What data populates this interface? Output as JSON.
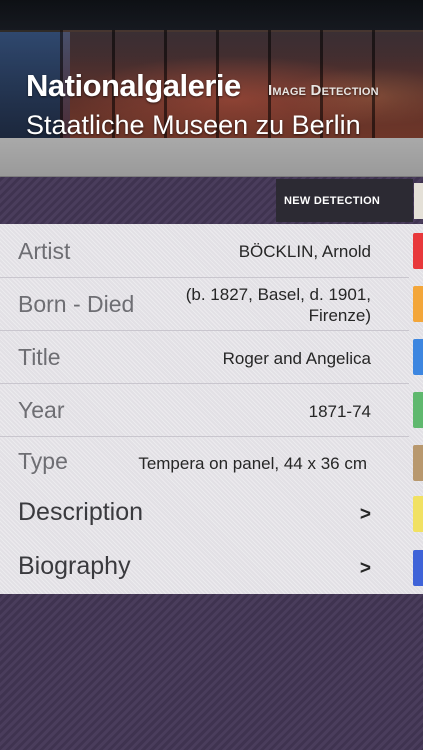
{
  "header": {
    "brand": "Nationalgalerie",
    "mode": "Image Detection",
    "subtitle": "Staatliche Museen zu Berlin"
  },
  "toolbar": {
    "new_detection_label": "NEW DETECTION"
  },
  "details": [
    {
      "label": "Artist",
      "value": "BÖCKLIN, Arnold",
      "color": "#e8383b"
    },
    {
      "label": "Born - Died",
      "value": "(b. 1827, Basel, d. 1901, Firenze)",
      "color": "#f3a63a"
    },
    {
      "label": "Title",
      "value": "Roger and Angelica",
      "color": "#3d86e0"
    },
    {
      "label": "Year",
      "value": "1871-74",
      "color": "#5fb86e"
    },
    {
      "label": "Type",
      "value": "Tempera on panel, 44 x 36 cm",
      "color": "#b8986e"
    }
  ],
  "links": [
    {
      "label": "Description",
      "chevron": ">",
      "color": "#f1e163"
    },
    {
      "label": "Biography",
      "chevron": ">",
      "color": "#3f63d8"
    }
  ]
}
